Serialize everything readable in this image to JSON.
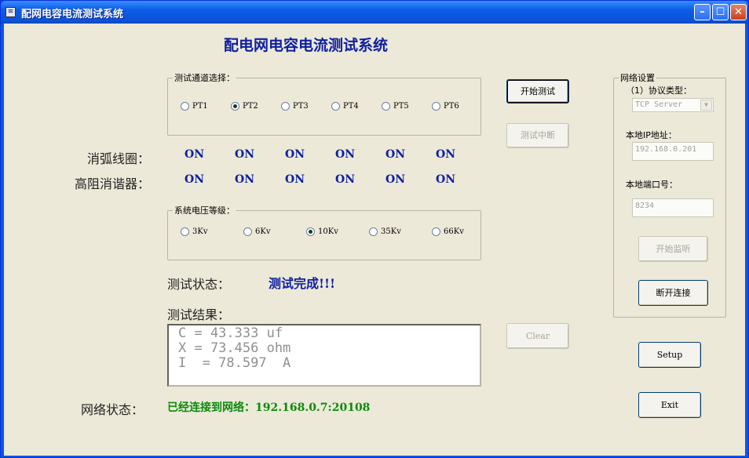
{
  "window": {
    "title": "配网电容电流测试系统",
    "icon_glyph": "≋",
    "min_glyph": "–",
    "max_glyph": "☐",
    "close_glyph": "✕"
  },
  "heading": "配电网电容电流测试系统",
  "channel_group": {
    "legend": "测试通道选择：",
    "options": [
      "PT1",
      "PT2",
      "PT3",
      "PT4",
      "PT5",
      "PT6"
    ],
    "selected": "PT2"
  },
  "rows": {
    "arc_coil_label": "消弧线圈：",
    "arc_coil_values": [
      "ON",
      "ON",
      "ON",
      "ON",
      "ON",
      "ON"
    ],
    "damper_label": "高阻消谐器：",
    "damper_values": [
      "ON",
      "ON",
      "ON",
      "ON",
      "ON",
      "ON"
    ]
  },
  "voltage_group": {
    "legend": "系统电压等级：",
    "options": [
      "3Kv",
      "6Kv",
      "10Kv",
      "35Kv",
      "66Kv"
    ],
    "selected": "10Kv"
  },
  "status": {
    "label": "测试状态：",
    "value": "测试完成!!!"
  },
  "result": {
    "label": "测试结果：",
    "lines": [
      "C = 43.333 uf",
      "X = 73.456 ohm",
      "I  = 78.597  A"
    ]
  },
  "network_status": {
    "label": "网络状态：",
    "value": "已经连接到网络：192.168.0.7:20108"
  },
  "buttons": {
    "start_test": "开始测试",
    "stop_test": "测试中断",
    "clear": "Clear",
    "setup": "Setup",
    "exit": "Exit"
  },
  "network_settings": {
    "legend": "网络设置",
    "protocol_label": "（1）协议类型：",
    "protocol_value": "TCP Server",
    "ip_label": "本地IP地址：",
    "ip_value": "192.168.0.201",
    "port_label": "本地端口号：",
    "port_value": "8234",
    "listen_button": "开始监听",
    "disconnect_button": "断开连接"
  }
}
